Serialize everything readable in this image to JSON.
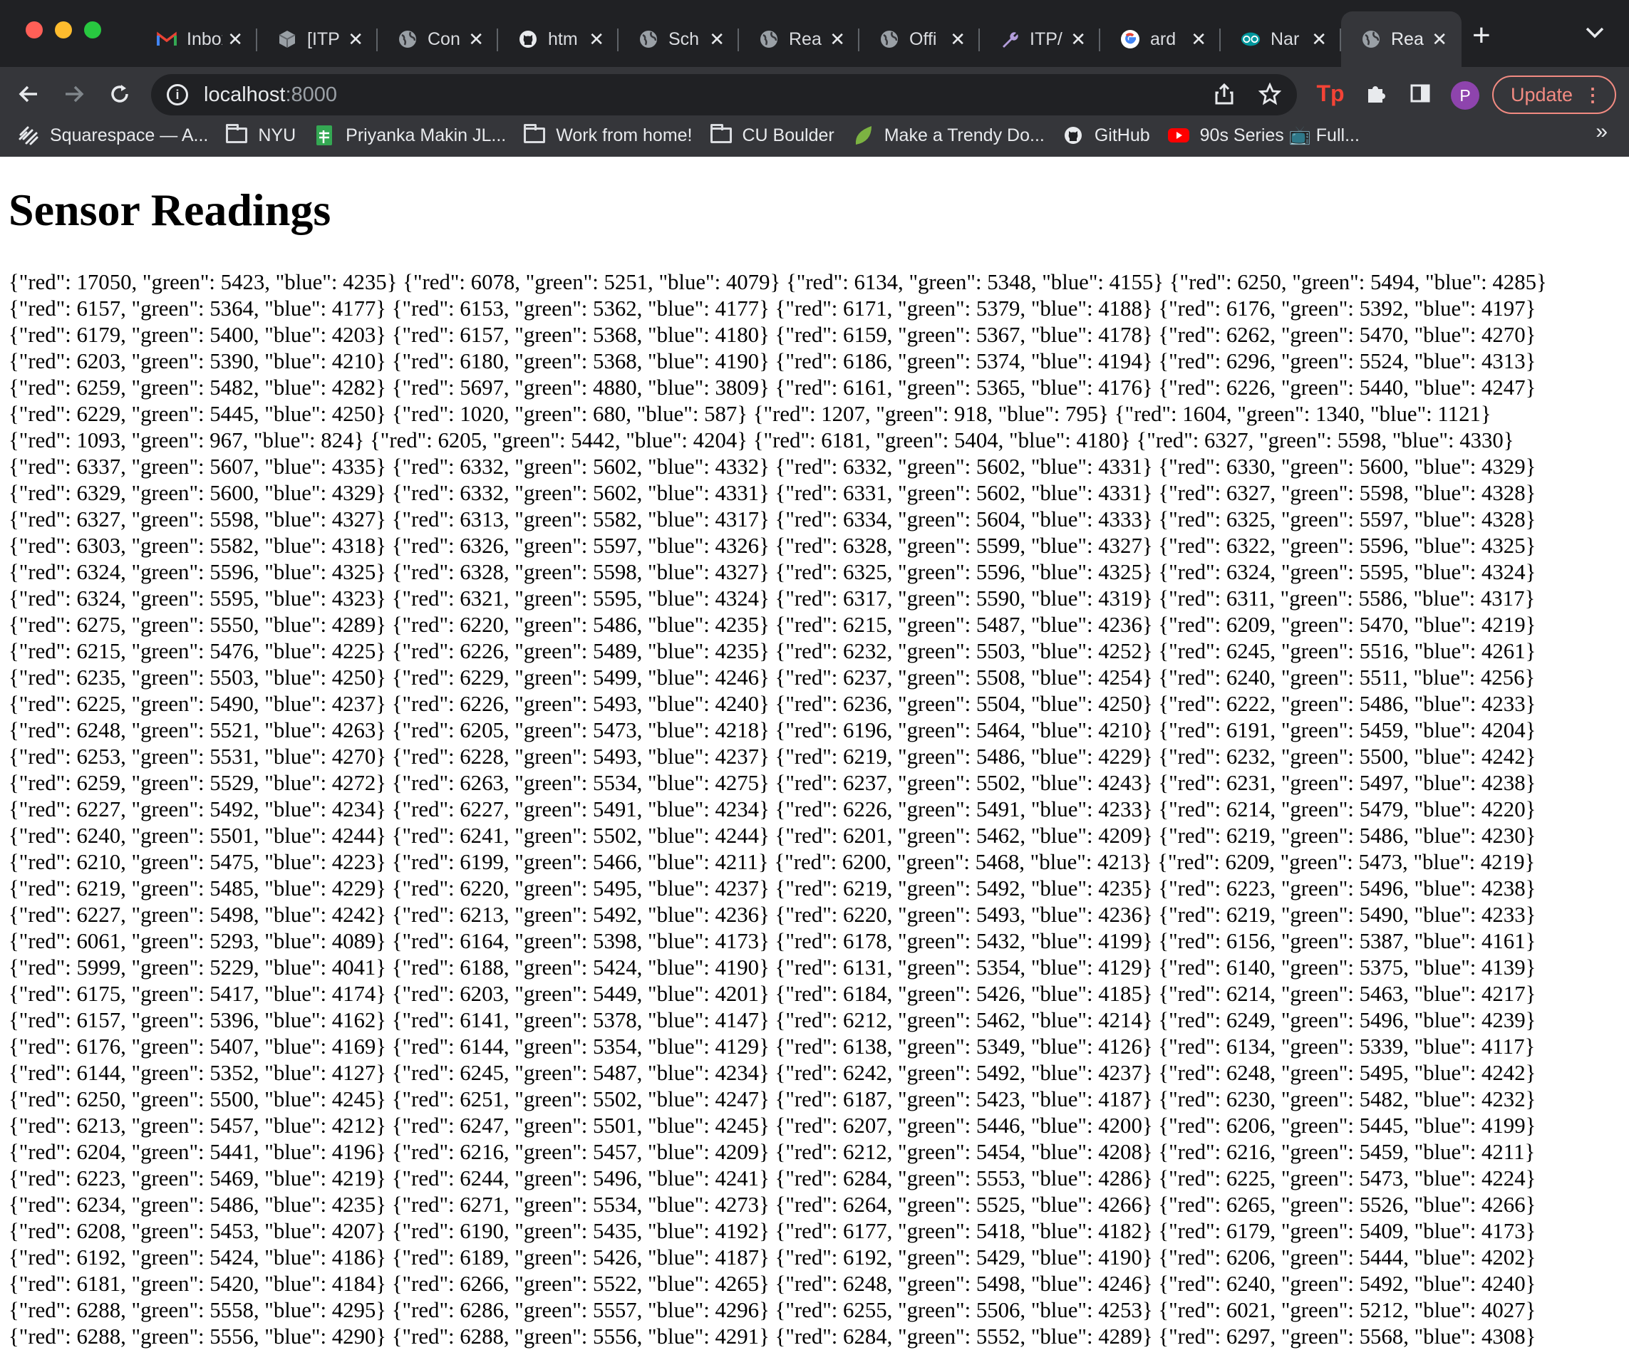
{
  "browser": {
    "tabs": [
      {
        "label": "Inbox",
        "icon": "gmail-icon",
        "color": "#ea4335"
      },
      {
        "label": "[ITP",
        "icon": "cube-icon",
        "color": "#9aa0a6"
      },
      {
        "label": "Con",
        "icon": "globe-icon",
        "color": "#9aa0a6"
      },
      {
        "label": "htm",
        "icon": "github-icon",
        "color": "#e8eaed"
      },
      {
        "label": "Sch",
        "icon": "globe-icon",
        "color": "#9aa0a6"
      },
      {
        "label": "Rea",
        "icon": "globe-icon",
        "color": "#9aa0a6"
      },
      {
        "label": "Offi",
        "icon": "globe-icon",
        "color": "#9aa0a6"
      },
      {
        "label": "ITP/",
        "icon": "wrench-icon",
        "color": "#b39ddb"
      },
      {
        "label": "ard",
        "icon": "google-icon",
        "color": "#4285f4"
      },
      {
        "label": "Nar",
        "icon": "arduino-icon",
        "color": "#00979d"
      },
      {
        "label": "Rea",
        "icon": "globe-icon",
        "color": "#9aa0a6",
        "active": true
      }
    ],
    "address": {
      "host": "localhost",
      "port": ":8000"
    },
    "update_label": "Update",
    "avatar_letter": "P",
    "bookmarks": [
      {
        "label": "Squarespace — A...",
        "icon": "squarespace-icon"
      },
      {
        "label": "NYU",
        "icon": "folder-icon"
      },
      {
        "label": "Priyanka Makin JL...",
        "icon": "sheets-icon"
      },
      {
        "label": "Work from home!",
        "icon": "folder-icon"
      },
      {
        "label": "CU Boulder",
        "icon": "folder-icon"
      },
      {
        "label": "Make a Trendy Do...",
        "icon": "leaf-icon"
      },
      {
        "label": "GitHub",
        "icon": "github-icon"
      },
      {
        "label": "90s Series 📺 Full...",
        "icon": "youtube-icon"
      }
    ]
  },
  "page": {
    "title": "Sensor Readings",
    "lines": [
      "{\"red\": 17050, \"green\": 5423, \"blue\": 4235} {\"red\": 6078, \"green\": 5251, \"blue\": 4079} {\"red\": 6134, \"green\": 5348, \"blue\": 4155} {\"red\": 6250, \"green\": 5494, \"blue\": 4285}",
      "{\"red\": 6157, \"green\": 5364, \"blue\": 4177} {\"red\": 6153, \"green\": 5362, \"blue\": 4177} {\"red\": 6171, \"green\": 5379, \"blue\": 4188} {\"red\": 6176, \"green\": 5392, \"blue\": 4197}",
      "{\"red\": 6179, \"green\": 5400, \"blue\": 4203} {\"red\": 6157, \"green\": 5368, \"blue\": 4180} {\"red\": 6159, \"green\": 5367, \"blue\": 4178} {\"red\": 6262, \"green\": 5470, \"blue\": 4270}",
      "{\"red\": 6203, \"green\": 5390, \"blue\": 4210} {\"red\": 6180, \"green\": 5368, \"blue\": 4190} {\"red\": 6186, \"green\": 5374, \"blue\": 4194} {\"red\": 6296, \"green\": 5524, \"blue\": 4313}",
      "{\"red\": 6259, \"green\": 5482, \"blue\": 4282} {\"red\": 5697, \"green\": 4880, \"blue\": 3809} {\"red\": 6161, \"green\": 5365, \"blue\": 4176} {\"red\": 6226, \"green\": 5440, \"blue\": 4247}",
      "{\"red\": 6229, \"green\": 5445, \"blue\": 4250} {\"red\": 1020, \"green\": 680, \"blue\": 587} {\"red\": 1207, \"green\": 918, \"blue\": 795} {\"red\": 1604, \"green\": 1340, \"blue\": 1121}",
      "{\"red\": 1093, \"green\": 967, \"blue\": 824} {\"red\": 6205, \"green\": 5442, \"blue\": 4204} {\"red\": 6181, \"green\": 5404, \"blue\": 4180} {\"red\": 6327, \"green\": 5598, \"blue\": 4330}",
      "{\"red\": 6337, \"green\": 5607, \"blue\": 4335} {\"red\": 6332, \"green\": 5602, \"blue\": 4332} {\"red\": 6332, \"green\": 5602, \"blue\": 4331} {\"red\": 6330, \"green\": 5600, \"blue\": 4329}",
      "{\"red\": 6329, \"green\": 5600, \"blue\": 4329} {\"red\": 6332, \"green\": 5602, \"blue\": 4331} {\"red\": 6331, \"green\": 5602, \"blue\": 4331} {\"red\": 6327, \"green\": 5598, \"blue\": 4328}",
      "{\"red\": 6327, \"green\": 5598, \"blue\": 4327} {\"red\": 6313, \"green\": 5582, \"blue\": 4317} {\"red\": 6334, \"green\": 5604, \"blue\": 4333} {\"red\": 6325, \"green\": 5597, \"blue\": 4328}",
      "{\"red\": 6303, \"green\": 5582, \"blue\": 4318} {\"red\": 6326, \"green\": 5597, \"blue\": 4326} {\"red\": 6328, \"green\": 5599, \"blue\": 4327} {\"red\": 6322, \"green\": 5596, \"blue\": 4325}",
      "{\"red\": 6324, \"green\": 5596, \"blue\": 4325} {\"red\": 6328, \"green\": 5598, \"blue\": 4327} {\"red\": 6325, \"green\": 5596, \"blue\": 4325} {\"red\": 6324, \"green\": 5595, \"blue\": 4324}",
      "{\"red\": 6324, \"green\": 5595, \"blue\": 4323} {\"red\": 6321, \"green\": 5595, \"blue\": 4324} {\"red\": 6317, \"green\": 5590, \"blue\": 4319} {\"red\": 6311, \"green\": 5586, \"blue\": 4317}",
      "{\"red\": 6275, \"green\": 5550, \"blue\": 4289} {\"red\": 6220, \"green\": 5486, \"blue\": 4235} {\"red\": 6215, \"green\": 5487, \"blue\": 4236} {\"red\": 6209, \"green\": 5470, \"blue\": 4219}",
      "{\"red\": 6215, \"green\": 5476, \"blue\": 4225} {\"red\": 6226, \"green\": 5489, \"blue\": 4235} {\"red\": 6232, \"green\": 5503, \"blue\": 4252} {\"red\": 6245, \"green\": 5516, \"blue\": 4261}",
      "{\"red\": 6235, \"green\": 5503, \"blue\": 4250} {\"red\": 6229, \"green\": 5499, \"blue\": 4246} {\"red\": 6237, \"green\": 5508, \"blue\": 4254} {\"red\": 6240, \"green\": 5511, \"blue\": 4256}",
      "{\"red\": 6225, \"green\": 5490, \"blue\": 4237} {\"red\": 6226, \"green\": 5493, \"blue\": 4240} {\"red\": 6236, \"green\": 5504, \"blue\": 4250} {\"red\": 6222, \"green\": 5486, \"blue\": 4233}",
      "{\"red\": 6248, \"green\": 5521, \"blue\": 4263} {\"red\": 6205, \"green\": 5473, \"blue\": 4218} {\"red\": 6196, \"green\": 5464, \"blue\": 4210} {\"red\": 6191, \"green\": 5459, \"blue\": 4204}",
      "{\"red\": 6253, \"green\": 5531, \"blue\": 4270} {\"red\": 6228, \"green\": 5493, \"blue\": 4237} {\"red\": 6219, \"green\": 5486, \"blue\": 4229} {\"red\": 6232, \"green\": 5500, \"blue\": 4242}",
      "{\"red\": 6259, \"green\": 5529, \"blue\": 4272} {\"red\": 6263, \"green\": 5534, \"blue\": 4275} {\"red\": 6237, \"green\": 5502, \"blue\": 4243} {\"red\": 6231, \"green\": 5497, \"blue\": 4238}",
      "{\"red\": 6227, \"green\": 5492, \"blue\": 4234} {\"red\": 6227, \"green\": 5491, \"blue\": 4234} {\"red\": 6226, \"green\": 5491, \"blue\": 4233} {\"red\": 6214, \"green\": 5479, \"blue\": 4220}",
      "{\"red\": 6240, \"green\": 5501, \"blue\": 4244} {\"red\": 6241, \"green\": 5502, \"blue\": 4244} {\"red\": 6201, \"green\": 5462, \"blue\": 4209} {\"red\": 6219, \"green\": 5486, \"blue\": 4230}",
      "{\"red\": 6210, \"green\": 5475, \"blue\": 4223} {\"red\": 6199, \"green\": 5466, \"blue\": 4211} {\"red\": 6200, \"green\": 5468, \"blue\": 4213} {\"red\": 6209, \"green\": 5473, \"blue\": 4219}",
      "{\"red\": 6219, \"green\": 5485, \"blue\": 4229} {\"red\": 6220, \"green\": 5495, \"blue\": 4237} {\"red\": 6219, \"green\": 5492, \"blue\": 4235} {\"red\": 6223, \"green\": 5496, \"blue\": 4238}",
      "{\"red\": 6227, \"green\": 5498, \"blue\": 4242} {\"red\": 6213, \"green\": 5492, \"blue\": 4236} {\"red\": 6220, \"green\": 5493, \"blue\": 4236} {\"red\": 6219, \"green\": 5490, \"blue\": 4233}",
      "{\"red\": 6061, \"green\": 5293, \"blue\": 4089} {\"red\": 6164, \"green\": 5398, \"blue\": 4173} {\"red\": 6178, \"green\": 5432, \"blue\": 4199} {\"red\": 6156, \"green\": 5387, \"blue\": 4161}",
      "{\"red\": 5999, \"green\": 5229, \"blue\": 4041} {\"red\": 6188, \"green\": 5424, \"blue\": 4190} {\"red\": 6131, \"green\": 5354, \"blue\": 4129} {\"red\": 6140, \"green\": 5375, \"blue\": 4139}",
      "{\"red\": 6175, \"green\": 5417, \"blue\": 4174} {\"red\": 6203, \"green\": 5449, \"blue\": 4201} {\"red\": 6184, \"green\": 5426, \"blue\": 4185} {\"red\": 6214, \"green\": 5463, \"blue\": 4217}",
      "{\"red\": 6157, \"green\": 5396, \"blue\": 4162} {\"red\": 6141, \"green\": 5378, \"blue\": 4147} {\"red\": 6212, \"green\": 5462, \"blue\": 4214} {\"red\": 6249, \"green\": 5496, \"blue\": 4239}",
      "{\"red\": 6176, \"green\": 5407, \"blue\": 4169} {\"red\": 6144, \"green\": 5354, \"blue\": 4129} {\"red\": 6138, \"green\": 5349, \"blue\": 4126} {\"red\": 6134, \"green\": 5339, \"blue\": 4117}",
      "{\"red\": 6144, \"green\": 5352, \"blue\": 4127} {\"red\": 6245, \"green\": 5487, \"blue\": 4234} {\"red\": 6242, \"green\": 5492, \"blue\": 4237} {\"red\": 6248, \"green\": 5495, \"blue\": 4242}",
      "{\"red\": 6250, \"green\": 5500, \"blue\": 4245} {\"red\": 6251, \"green\": 5502, \"blue\": 4247} {\"red\": 6187, \"green\": 5423, \"blue\": 4187} {\"red\": 6230, \"green\": 5482, \"blue\": 4232}",
      "{\"red\": 6213, \"green\": 5457, \"blue\": 4212} {\"red\": 6247, \"green\": 5501, \"blue\": 4245} {\"red\": 6207, \"green\": 5446, \"blue\": 4200} {\"red\": 6206, \"green\": 5445, \"blue\": 4199}",
      "{\"red\": 6204, \"green\": 5441, \"blue\": 4196} {\"red\": 6216, \"green\": 5457, \"blue\": 4209} {\"red\": 6212, \"green\": 5454, \"blue\": 4208} {\"red\": 6216, \"green\": 5459, \"blue\": 4211}",
      "{\"red\": 6223, \"green\": 5469, \"blue\": 4219} {\"red\": 6244, \"green\": 5496, \"blue\": 4241} {\"red\": 6284, \"green\": 5553, \"blue\": 4286} {\"red\": 6225, \"green\": 5473, \"blue\": 4224}",
      "{\"red\": 6234, \"green\": 5486, \"blue\": 4235} {\"red\": 6271, \"green\": 5534, \"blue\": 4273} {\"red\": 6264, \"green\": 5525, \"blue\": 4266} {\"red\": 6265, \"green\": 5526, \"blue\": 4266}",
      "{\"red\": 6208, \"green\": 5453, \"blue\": 4207} {\"red\": 6190, \"green\": 5435, \"blue\": 4192} {\"red\": 6177, \"green\": 5418, \"blue\": 4182} {\"red\": 6179, \"green\": 5409, \"blue\": 4173}",
      "{\"red\": 6192, \"green\": 5424, \"blue\": 4186} {\"red\": 6189, \"green\": 5426, \"blue\": 4187} {\"red\": 6192, \"green\": 5429, \"blue\": 4190} {\"red\": 6206, \"green\": 5444, \"blue\": 4202}",
      "{\"red\": 6181, \"green\": 5420, \"blue\": 4184} {\"red\": 6266, \"green\": 5522, \"blue\": 4265} {\"red\": 6248, \"green\": 5498, \"blue\": 4246} {\"red\": 6240, \"green\": 5492, \"blue\": 4240}",
      "{\"red\": 6288, \"green\": 5558, \"blue\": 4295} {\"red\": 6286, \"green\": 5557, \"blue\": 4296} {\"red\": 6255, \"green\": 5506, \"blue\": 4253} {\"red\": 6021, \"green\": 5212, \"blue\": 4027}",
      "{\"red\": 6288, \"green\": 5556, \"blue\": 4290} {\"red\": 6288, \"green\": 5556, \"blue\": 4291} {\"red\": 6284, \"green\": 5552, \"blue\": 4289} {\"red\": 6297, \"green\": 5568, \"blue\": 4308}"
    ]
  }
}
